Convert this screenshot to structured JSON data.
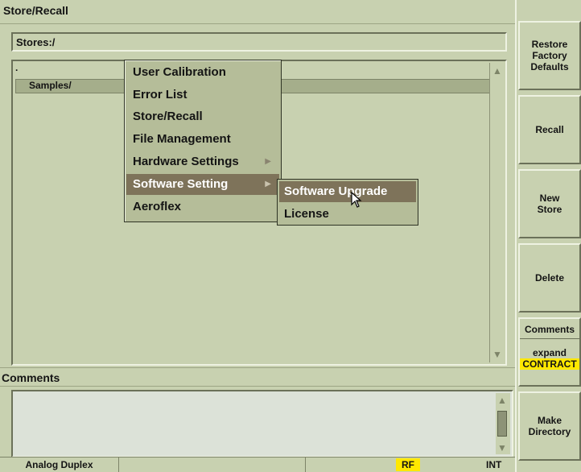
{
  "window": {
    "title": "Store/Recall"
  },
  "path": {
    "value": "Stores:/"
  },
  "file_list": {
    "dot_entry": ".",
    "items": [
      "Samples/"
    ]
  },
  "comments": {
    "title": "Comments",
    "value": ""
  },
  "status_bar": {
    "mode": "Analog Duplex",
    "rf": "RF",
    "ref": "INT",
    "rf_color": "#ffe800"
  },
  "softkeys": {
    "restore": [
      "Restore",
      "Factory",
      "Defaults"
    ],
    "recall": "Recall",
    "new_store": [
      "New",
      "Store"
    ],
    "delete": "Delete",
    "comments": "Comments",
    "expand": "expand",
    "contract": "CONTRACT",
    "make_dir": [
      "Make",
      "Directory"
    ]
  },
  "menu": {
    "items": [
      "User Calibration",
      "Error List",
      "Store/Recall",
      "File Management",
      "Hardware Settings",
      "Software Setting",
      "Aeroflex"
    ],
    "highlighted": "Software Setting"
  },
  "submenu": {
    "items": [
      "Software Upgrade",
      "License"
    ],
    "highlighted": "Software Upgrade"
  },
  "colors": {
    "panel_bg": "#c8d1b0",
    "menu_highlight": "#7e735a",
    "contract_highlight": "#ffe800"
  }
}
